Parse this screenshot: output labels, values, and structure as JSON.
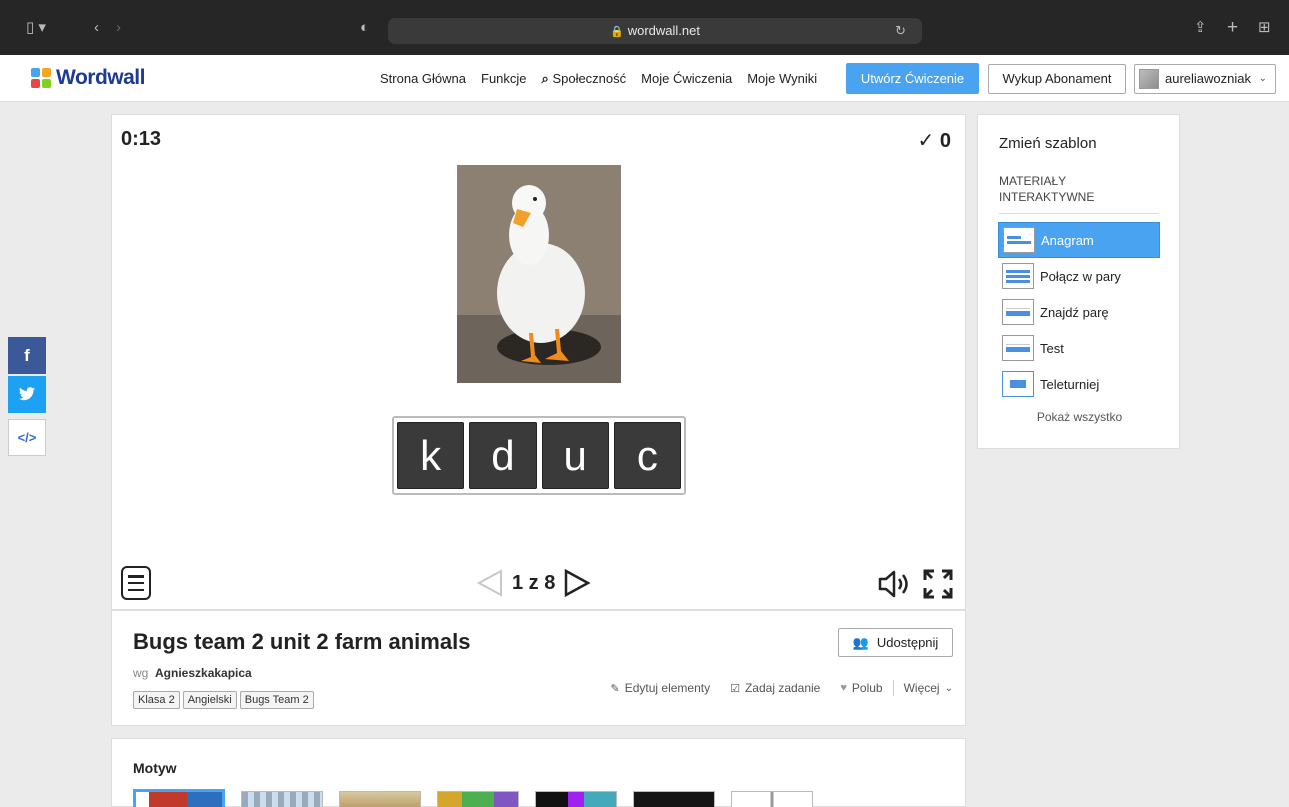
{
  "browser": {
    "url": "wordwall.net"
  },
  "header": {
    "logo_text": "Wordwall",
    "nav": [
      "Strona Główna",
      "Funkcje",
      "Społeczność",
      "Moje Ćwiczenia",
      "Moje Wyniki"
    ],
    "create_label": "Utwórz Ćwiczenie",
    "subscribe_label": "Wykup Abonament",
    "username": "aureliawozniak"
  },
  "social": {
    "facebook": "f",
    "twitter": "t",
    "embed": "</>"
  },
  "activity": {
    "timer": "0:13",
    "score_mark": "✓",
    "score": "0",
    "letters": [
      "k",
      "d",
      "u",
      "c"
    ],
    "page_text": "1 z 8",
    "current_page": 1,
    "total_pages": 8
  },
  "info": {
    "title": "Bugs team 2 unit 2 farm animals",
    "share_label": "Udostępnij",
    "author_prefix": "wg",
    "author": "Agnieszkakapica",
    "tags": [
      "Klasa 2",
      "Angielski",
      "Bugs Team 2"
    ],
    "edit_label": "Edytuj elementy",
    "assign_label": "Zadaj zadanie",
    "like_label": "Polub",
    "more_label": "Więcej"
  },
  "theme": {
    "heading": "Motyw"
  },
  "templates": {
    "title": "Zmień szablon",
    "section_line1": "MATERIAŁY",
    "section_line2": "INTERAKTYWNE",
    "items": [
      "Anagram",
      "Połącz w pary",
      "Znajdź parę",
      "Test",
      "Teleturniej"
    ],
    "active": "Anagram",
    "show_all": "Pokaż wszystko"
  },
  "colors": {
    "accent": "#4aa3f0",
    "facebook": "#3b5998",
    "twitter": "#1da1f2",
    "tile": "#3a3a3a"
  }
}
